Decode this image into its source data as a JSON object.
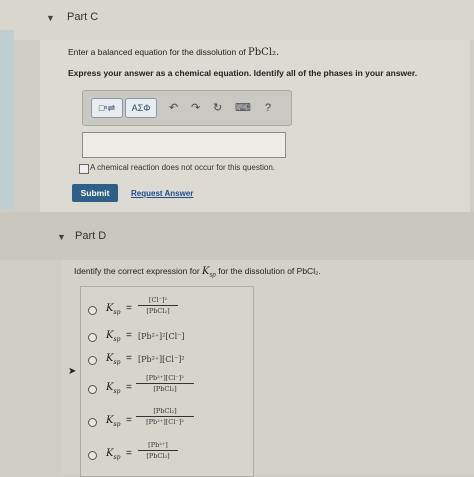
{
  "part_c": {
    "title": "Part C",
    "prompt_prefix": "Enter a balanced equation for the dissolution of ",
    "prompt_compound": "PbCl₂.",
    "instruction": "Express your answer as a chemical equation. Identify all of the phases in your answer.",
    "toolbar": {
      "template_btn": "□ⁿ⇌",
      "symbols_btn": "AΣΦ",
      "undo": "↶",
      "redo": "↷",
      "reset": "↻",
      "keyboard": "⌨",
      "help": "?"
    },
    "answer_value": "",
    "no_reaction_label": "A chemical reaction does not occur for this question.",
    "submit_label": "Submit",
    "request_answer_label": "Request Answer"
  },
  "part_d": {
    "title": "Part D",
    "prompt_prefix": "Identify the correct expression for ",
    "prompt_ksp": "K",
    "prompt_ksp_sub": "sp",
    "prompt_suffix": " for the dissolution of PbCl₂.",
    "ksp_label": "K",
    "ksp_sub": "sp",
    "equals": "=",
    "options": [
      {
        "numerator": "[Cl⁻]²",
        "denominator": "[PbCl₂]"
      },
      {
        "expression": "[Pb²⁺]²[Cl⁻]"
      },
      {
        "expression": "[Pb²⁺][Cl⁻]²"
      },
      {
        "numerator": "[Pb²⁺][Cl⁻]²",
        "denominator": "[PbCl₂]"
      },
      {
        "numerator": "[PbCl₂]",
        "denominator": "[Pb²⁺][Cl⁻]²"
      },
      {
        "numerator": "[Pb²⁺]",
        "denominator": "[PbCl₂]"
      }
    ]
  }
}
